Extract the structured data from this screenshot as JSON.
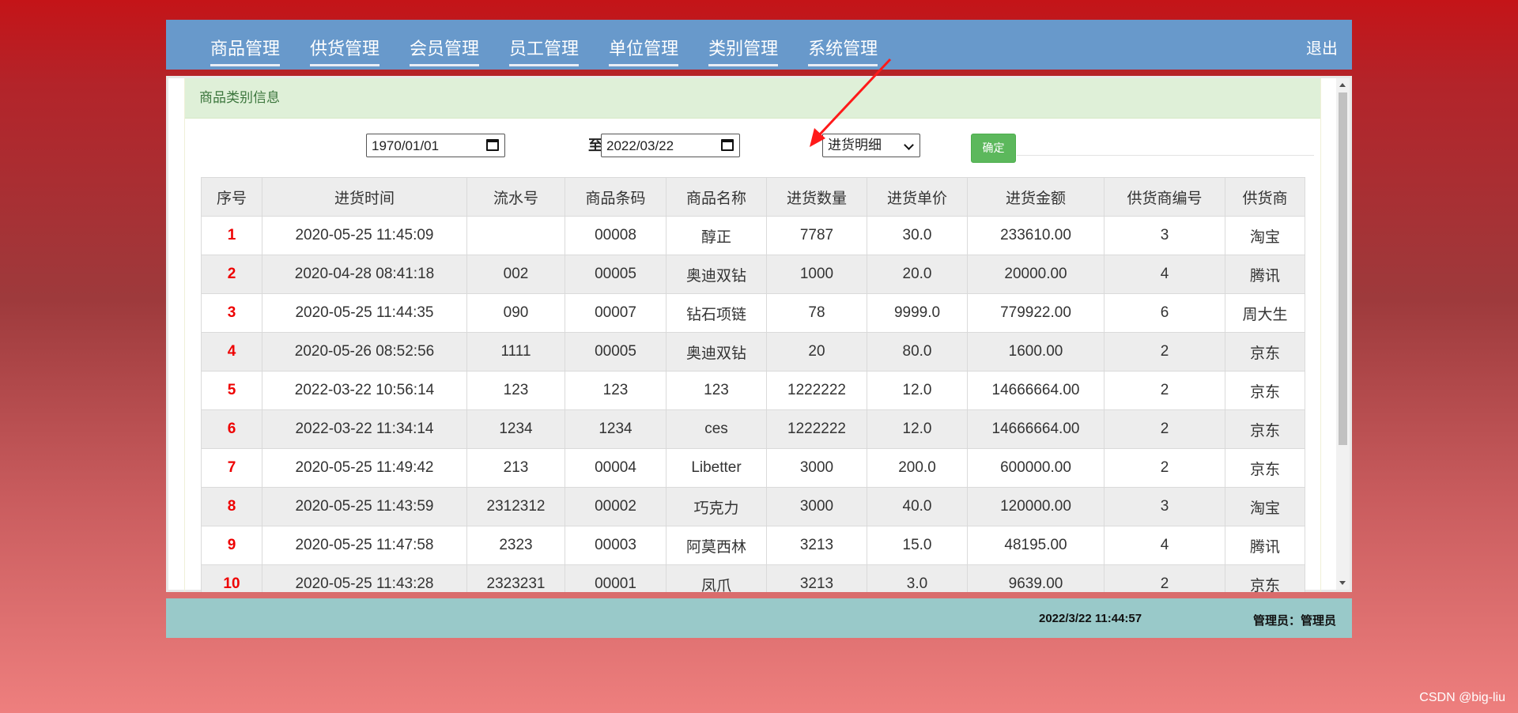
{
  "nav": {
    "items": [
      "商品管理",
      "供货管理",
      "会员管理",
      "员工管理",
      "单位管理",
      "类别管理",
      "系统管理"
    ],
    "logout": "退出"
  },
  "panel": {
    "title": "商品类别信息"
  },
  "filters": {
    "start_date": "1970/01/01",
    "to_label": "至",
    "end_date": "2022/03/22",
    "type_selected": "进货明细",
    "confirm_label": "确定"
  },
  "table": {
    "columns": [
      "序号",
      "进货时间",
      "流水号",
      "商品条码",
      "商品名称",
      "进货数量",
      "进货单价",
      "进货金额",
      "供货商编号",
      "供货商"
    ],
    "rows": [
      [
        "1",
        "2020-05-25 11:45:09",
        "",
        "00008",
        "醇正",
        "7787",
        "30.0",
        "233610.00",
        "3",
        "淘宝"
      ],
      [
        "2",
        "2020-04-28 08:41:18",
        "002",
        "00005",
        "奥迪双钻",
        "1000",
        "20.0",
        "20000.00",
        "4",
        "腾讯"
      ],
      [
        "3",
        "2020-05-25 11:44:35",
        "090",
        "00007",
        "钻石项链",
        "78",
        "9999.0",
        "779922.00",
        "6",
        "周大生"
      ],
      [
        "4",
        "2020-05-26 08:52:56",
        "1111",
        "00005",
        "奥迪双钻",
        "20",
        "80.0",
        "1600.00",
        "2",
        "京东"
      ],
      [
        "5",
        "2022-03-22 10:56:14",
        "123",
        "123",
        "123",
        "1222222",
        "12.0",
        "14666664.00",
        "2",
        "京东"
      ],
      [
        "6",
        "2022-03-22 11:34:14",
        "1234",
        "1234",
        "ces",
        "1222222",
        "12.0",
        "14666664.00",
        "2",
        "京东"
      ],
      [
        "7",
        "2020-05-25 11:49:42",
        "213",
        "00004",
        "Libetter",
        "3000",
        "200.0",
        "600000.00",
        "2",
        "京东"
      ],
      [
        "8",
        "2020-05-25 11:43:59",
        "2312312",
        "00002",
        "巧克力",
        "3000",
        "40.0",
        "120000.00",
        "3",
        "淘宝"
      ],
      [
        "9",
        "2020-05-25 11:47:58",
        "2323",
        "00003",
        "阿莫西林",
        "3213",
        "15.0",
        "48195.00",
        "4",
        "腾讯"
      ],
      [
        "10",
        "2020-05-25 11:43:28",
        "2323231",
        "00001",
        "凤爪",
        "3213",
        "3.0",
        "9639.00",
        "2",
        "京东"
      ]
    ]
  },
  "footer": {
    "datetime": "2022/3/22 11:44:57",
    "admin": "管理员：管理员"
  },
  "watermark": "CSDN @big-liu"
}
